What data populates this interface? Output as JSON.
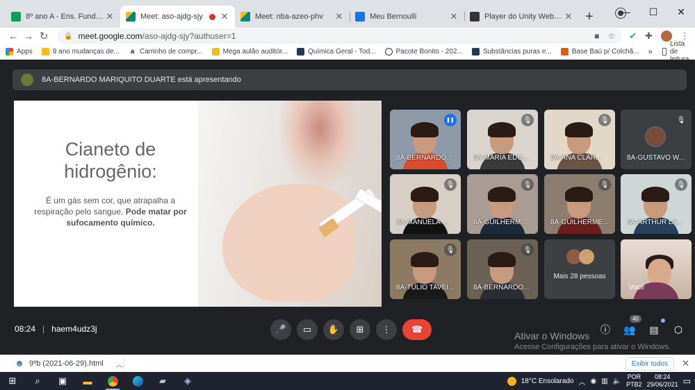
{
  "browser": {
    "tabs": [
      {
        "title": "8º ano A - Ens. Fundamental",
        "favicon_color": "#0f9d58"
      },
      {
        "title": "Meet: aso-ajdg-sjy",
        "favicon_color": "#00897b",
        "recording": true
      },
      {
        "title": "Meet: nba-azeo-phv",
        "favicon_color": "#00897b"
      },
      {
        "title": "Meu Bernoulli",
        "favicon_color": "#1a73e8"
      },
      {
        "title": "Player do Unity WebGL | Recu",
        "favicon_color": "#333333"
      }
    ],
    "url_host": "meet.google.com",
    "url_path": "/aso-ajdg-sjy?authuser=1",
    "bookmarks": [
      {
        "label": "Apps",
        "color": "#ea4335"
      },
      {
        "label": "9 ano mudanças de...",
        "color": "#fbbc04"
      },
      {
        "label": "Carrinho de compr...",
        "color": "#232f3e"
      },
      {
        "label": "Mega aulão auditór...",
        "color": "#fbbc04"
      },
      {
        "label": "Química Geral - Tod...",
        "color": "#1e3a5f"
      },
      {
        "label": "Pacote Bonito - 202...",
        "color": "#333333"
      },
      {
        "label": "Substâncias puras e...",
        "color": "#1e3a5f"
      },
      {
        "label": "Base Baú p/ Colchã...",
        "color": "#e65c00"
      }
    ],
    "bookmarks_more": "»",
    "reading_list": "Lista de leitura"
  },
  "meet": {
    "presenting_text": "8A-BERNARDO MARIQUITO DUARTE está apresentando",
    "slide": {
      "title": "Cianeto de hidrogênio:",
      "body_normal": "É um gás sem cor, que atrapalha a respiração pelo sangue.",
      "body_bold": "Pode matar por sufocamento químico."
    },
    "participants": [
      {
        "name": "8A-BERNARDO...",
        "speaking": true,
        "bg": "#8f9aa8",
        "shirt": "#d94b2b"
      },
      {
        "name": "8A-MARIA EDU...",
        "speaking": false,
        "bg": "#d9d4cd",
        "shirt": "#3a3a3a"
      },
      {
        "name": "8A-ANA CLAR...",
        "speaking": false,
        "bg": "#e2d8c9",
        "shirt": "#6a5544"
      },
      {
        "name": "8A-GUSTAVO W...",
        "speaking": false,
        "bg": "#3c4043",
        "shirt": "#3c4043",
        "avatar_only": true
      },
      {
        "name": "8A-MANUELA ...",
        "speaking": false,
        "bg": "#d7cfc6",
        "shirt": "#111111"
      },
      {
        "name": "8A-GUILHERM...",
        "speaking": false,
        "bg": "#a89c95",
        "shirt": "#1c2a3a"
      },
      {
        "name": "8A-GUILHERME...",
        "speaking": false,
        "bg": "#8b7e70",
        "shirt": "#6d1d1d"
      },
      {
        "name": "8A-ARTHUR LA...",
        "speaking": false,
        "bg": "#cfd7d6",
        "shirt": "#27405e"
      },
      {
        "name": "8A-TÚLIO TAVEI...",
        "speaking": false,
        "bg": "#8d7a62",
        "shirt": "#1a1a1a"
      },
      {
        "name": "8A-BERNARDO...",
        "speaking": false,
        "bg": "#6b6154",
        "shirt": "#2a2d33"
      }
    ],
    "more_people": "Mais 28 pessoas",
    "self_label": "Você",
    "meeting_time": "08:24",
    "meeting_code": "haem4udz3j",
    "participants_count": "40",
    "windows_watermark_title": "Ativar o Windows",
    "windows_watermark_sub": "Acesse Configurações para ativar o Windows."
  },
  "downloads": {
    "file": "9ºb (2021-06-29).html",
    "show_all": "Exibir todos"
  },
  "taskbar": {
    "weather": "18°C Ensolarado",
    "lang_top": "POR",
    "lang_bottom": "PTB2",
    "time": "08:24",
    "date": "29/06/2021"
  }
}
